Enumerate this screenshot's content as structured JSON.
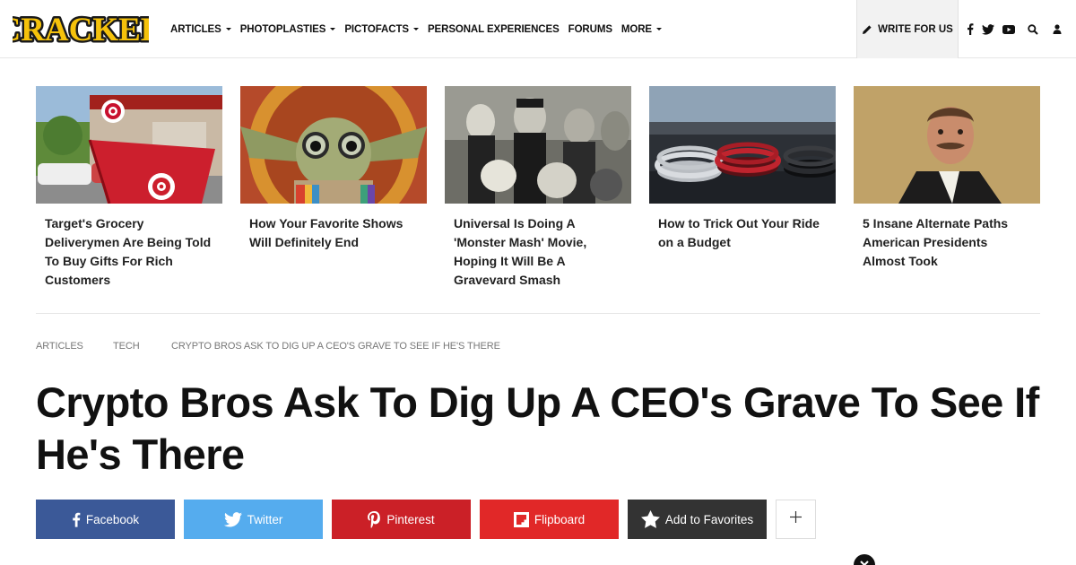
{
  "brand": {
    "logo_text": "CRACKED"
  },
  "nav": {
    "items": [
      {
        "label": "ARTICLES",
        "dropdown": true
      },
      {
        "label": "PHOTOPLASTIES",
        "dropdown": true
      },
      {
        "label": "PICTOFACTS",
        "dropdown": true
      },
      {
        "label": "PERSONAL EXPERIENCES",
        "dropdown": false
      },
      {
        "label": "FORUMS",
        "dropdown": false
      },
      {
        "label": "MORE",
        "dropdown": true
      }
    ],
    "write_label": "WRITE FOR US",
    "icons": [
      "facebook-icon",
      "twitter-icon",
      "youtube-icon",
      "search-icon",
      "user-icon"
    ]
  },
  "related": [
    {
      "title": "Target's Grocery Deliverymen Are Being Told To Buy Gifts For Rich Customers",
      "image": "target-cart-photo"
    },
    {
      "title": "How Your Favorite Shows Will Definitely End",
      "image": "baby-yoda-glasses-photo"
    },
    {
      "title": "Universal Is Doing A 'Monster Mash' Movie, Hoping It Will Be A Gravevard Smash",
      "image": "universal-monsters-photo"
    },
    {
      "title": "How to Trick Out Your Ride on a Budget",
      "image": "car-dashboard-rings-photo"
    },
    {
      "title": "5 Insane Alternate Paths American Presidents Almost Took",
      "image": "teddy-roosevelt-portrait"
    }
  ],
  "breadcrumb": [
    "ARTICLES",
    "TECH",
    "CRYPTO BROS ASK TO DIG UP A CEO'S GRAVE TO SEE IF HE'S THERE"
  ],
  "article": {
    "title": "Crypto Bros Ask To Dig Up A CEO's Grave To See If He's There"
  },
  "share": {
    "buttons": [
      {
        "label": "Facebook",
        "color": "#3b5998"
      },
      {
        "label": "Twitter",
        "color": "#55acee"
      },
      {
        "label": "Pinterest",
        "color": "#cb2027"
      },
      {
        "label": "Flipboard",
        "color": "#e12828"
      },
      {
        "label": "Add to Favorites",
        "color": "#333333"
      }
    ]
  },
  "colors": {
    "logo_fill": "#f5c20b",
    "logo_stroke": "#1a1a1a",
    "text": "#111111"
  }
}
